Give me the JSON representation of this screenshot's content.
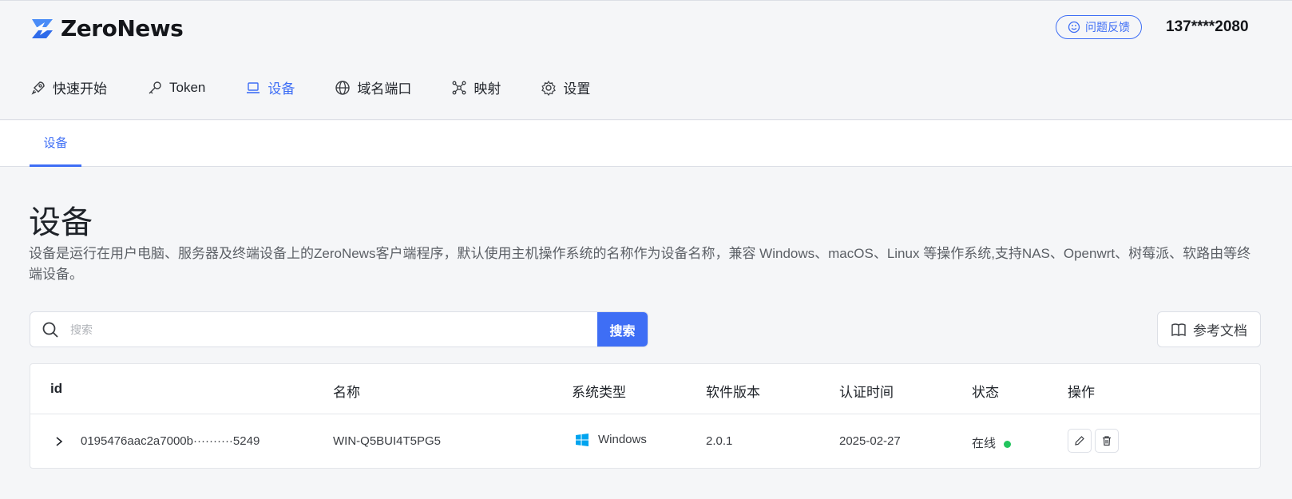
{
  "app": {
    "brand": "ZeroNews",
    "feedback_label": "问题反馈",
    "user_phone": "137****2080"
  },
  "nav": {
    "items": [
      {
        "label": "快速开始",
        "icon": "rocket-icon"
      },
      {
        "label": "Token",
        "icon": "key-icon"
      },
      {
        "label": "设备",
        "icon": "laptop-icon",
        "active": true
      },
      {
        "label": "域名端口",
        "icon": "globe-icon"
      },
      {
        "label": "映射",
        "icon": "network-icon"
      },
      {
        "label": "设置",
        "icon": "gear-icon"
      }
    ]
  },
  "subtabs": {
    "active": "设备"
  },
  "page": {
    "title": "设备",
    "description": "设备是运行在用户电脑、服务器及终端设备上的ZeroNews客户端程序，默认使用主机操作系统的名称作为设备名称，兼容 Windows、macOS、Linux 等操作系统,支持NAS、Openwrt、树莓派、软路由等终端设备。"
  },
  "search": {
    "placeholder": "搜索",
    "value": "",
    "button_label": "搜索"
  },
  "docs_button": {
    "label": "参考文档"
  },
  "table": {
    "columns": [
      "id",
      "名称",
      "系统类型",
      "软件版本",
      "认证时间",
      "状态",
      "操作"
    ],
    "rows": [
      {
        "id": "0195476aac2a7000b··········5249",
        "name": "WIN-Q5BUI4T5PG5",
        "os": "Windows",
        "version": "2.0.1",
        "auth_time": "2025-02-27",
        "status": "在线"
      }
    ]
  },
  "colors": {
    "accent": "#3e6ef5",
    "online": "#22c55e",
    "windows_blue": "#00a4ef"
  }
}
